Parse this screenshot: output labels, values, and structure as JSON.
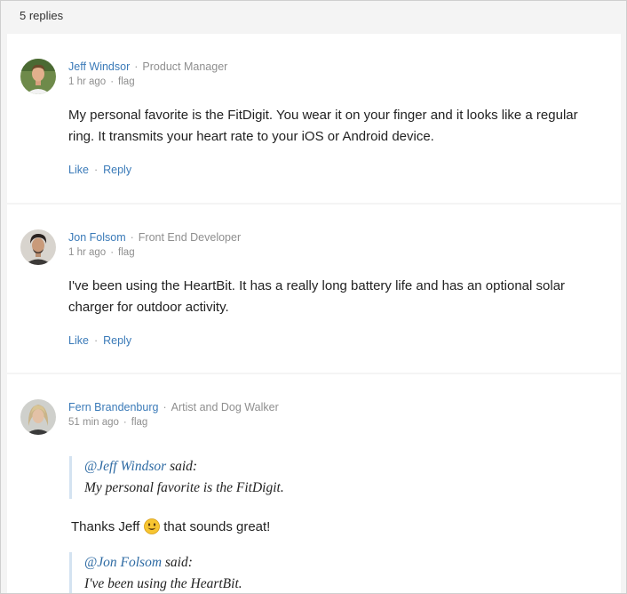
{
  "header": {
    "replies_label": "5 replies"
  },
  "comments": [
    {
      "name": "Jeff Windsor",
      "role": "Product Manager",
      "time": "1 hr ago",
      "flag": "flag",
      "body": "My personal favorite is the FitDigit. You wear it on your finger and it looks like a regular ring. It transmits your heart rate to your iOS or Android device.",
      "like": "Like",
      "reply": "Reply"
    },
    {
      "name": "Jon Folsom",
      "role": "Front End Developer",
      "time": "1 hr ago",
      "flag": "flag",
      "body": "I've been using the HeartBit. It has a really long battery life and has an optional solar charger for outdoor activity.",
      "like": "Like",
      "reply": "Reply"
    },
    {
      "name": "Fern Brandenburg",
      "role": "Artist and Dog Walker",
      "time": "51 min ago",
      "flag": "flag",
      "quotes": [
        {
          "mention": "@Jeff Windsor",
          "said": " said:",
          "text": "My personal favorite is the FitDigit."
        },
        {
          "mention": "@Jon Folsom",
          "said": " said:",
          "text": "I've been using the HeartBit."
        }
      ],
      "thanks_before": "Thanks Jeff",
      "thanks_emoji": "smiling-face-icon",
      "thanks_after": "that sounds great!"
    }
  ],
  "colors": {
    "link": "#3a7ab8",
    "quote_border": "#d4e3f1",
    "background": "#f4f4f4"
  }
}
